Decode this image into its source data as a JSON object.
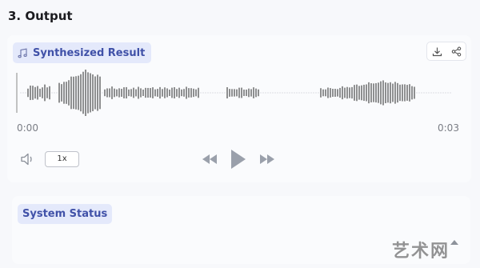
{
  "section": {
    "title": "3. Output"
  },
  "result": {
    "label": "Synthesized Result",
    "icon": "music-note-icon",
    "tools": [
      "download-icon",
      "share-icon"
    ]
  },
  "player": {
    "time_start": "0:00",
    "time_end": "0:03",
    "speed": "1x",
    "icons": [
      "volume-icon",
      "rewind-icon",
      "play-icon",
      "fast-forward-icon"
    ]
  },
  "status": {
    "label": "System Status"
  },
  "watermark": {
    "text": "艺术网"
  },
  "colors": {
    "accent_bg": "#e4e9fb",
    "accent_text": "#4051a8",
    "wave_bar": "#555555",
    "control_gray": "#9aa0ab"
  }
}
